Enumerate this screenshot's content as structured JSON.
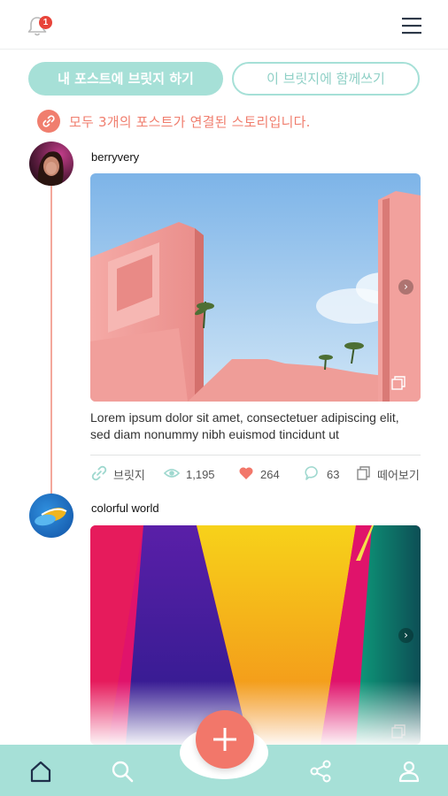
{
  "header": {
    "notification_count": "1",
    "icons": {
      "notifications": "bell-icon",
      "menu": "hamburger-menu-icon"
    }
  },
  "actions": {
    "primary_label": "내 포스트에 브릿지 하기",
    "secondary_label": "이 브릿지에 함께쓰기"
  },
  "notice": {
    "text": "모두 3개의  포스트가 연결된 스토리입니다.",
    "icon": "link-icon"
  },
  "posts": [
    {
      "username": "berryvery",
      "image": "pink-building-sky-photo",
      "description": "Lorem ipsum dolor sit amet, consectetuer adipiscing elit, sed diam nonummy nibh euismod tincidunt ut",
      "stats": {
        "bridge_label": "브릿지",
        "views": "1,195",
        "likes": "264",
        "comments": "63",
        "detail_label": "떼어보기"
      }
    },
    {
      "username": "colorful world",
      "image": "colorful-gradient-photo"
    }
  ],
  "colors": {
    "mint": "#a6e0d7",
    "coral": "#f2776a",
    "timeline": "#f3a79b"
  },
  "bottom_nav": {
    "items": [
      "home-icon",
      "search-icon",
      "add-icon",
      "share-icon",
      "profile-icon"
    ]
  }
}
